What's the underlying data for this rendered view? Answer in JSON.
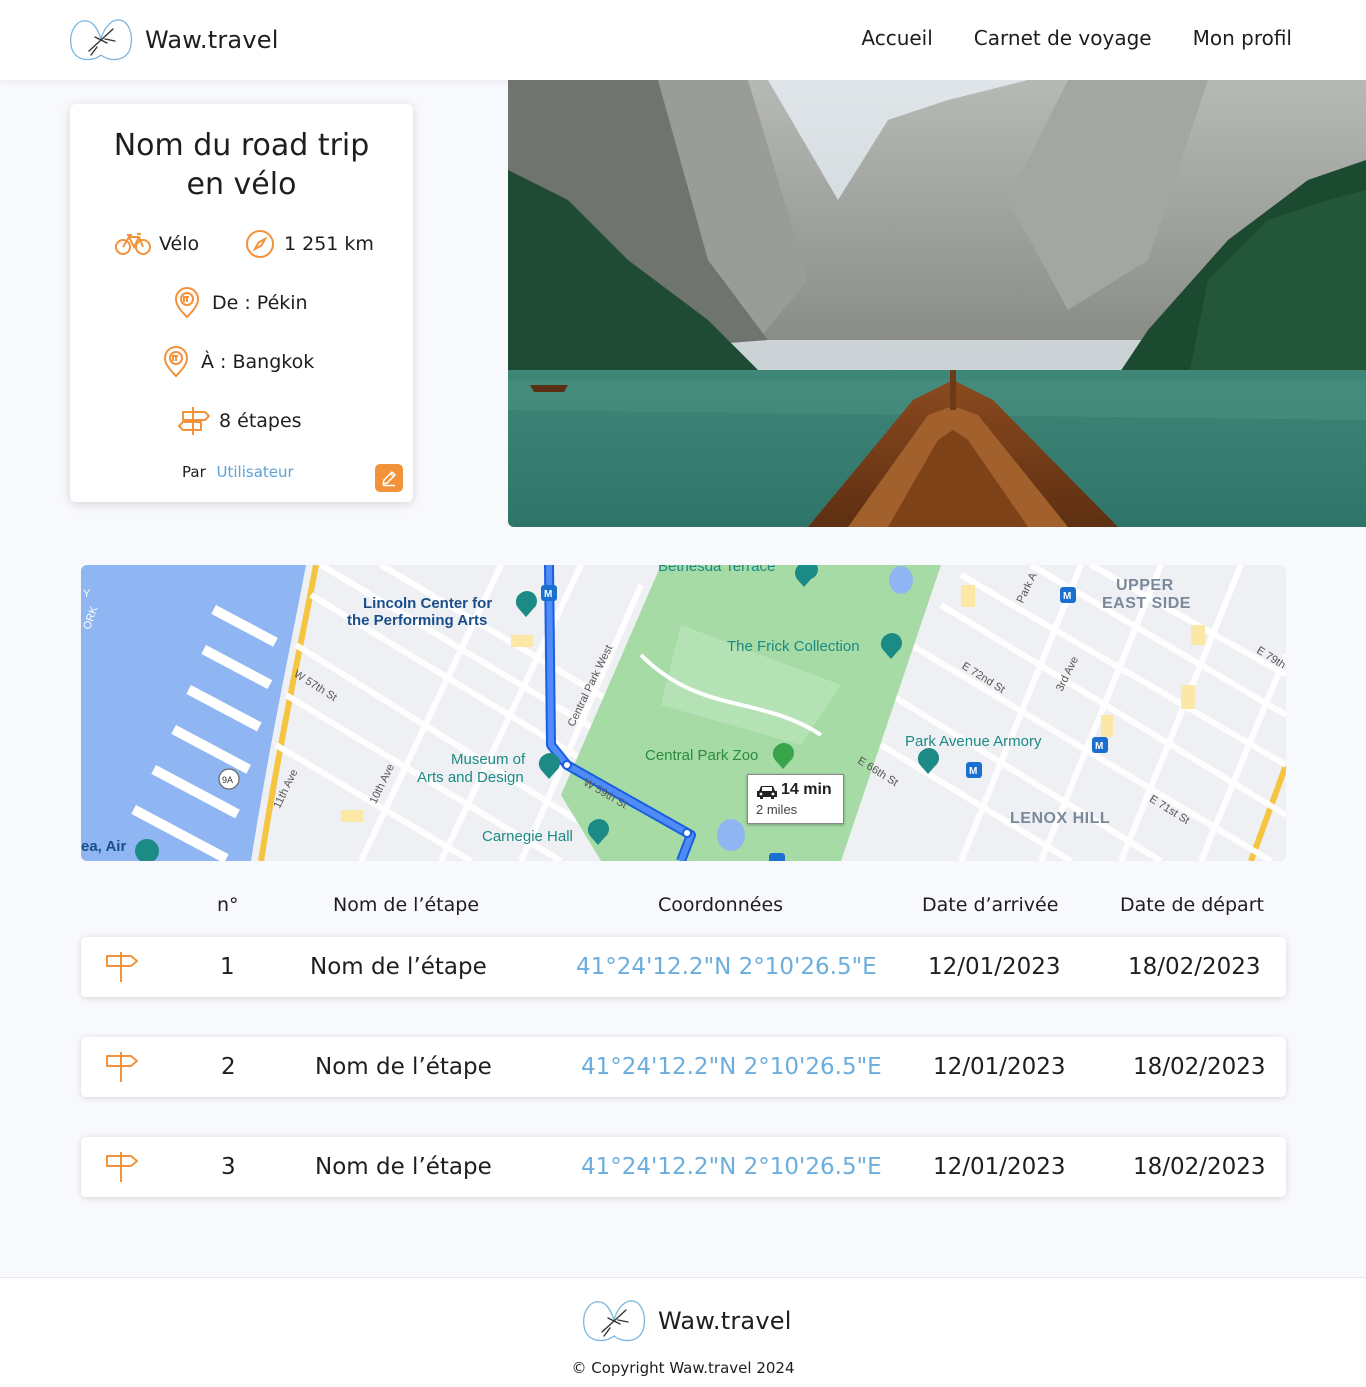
{
  "brand": {
    "name": "Waw.travel"
  },
  "nav": {
    "items": [
      "Accueil",
      "Carnet de voyage",
      "Mon profil"
    ]
  },
  "trip": {
    "title": "Nom du road trip en vélo",
    "mode": "Vélo",
    "distance": "1 251 km",
    "from": "De : Pékin",
    "to": "À : Bangkok",
    "stages": "8 étapes",
    "by_label": "Par",
    "author": "Utilisateur"
  },
  "map": {
    "labels": {
      "lincoln": "Lincoln Center for",
      "lincoln2": "the Performing Arts",
      "bethesda": "Bethesda Terrace",
      "frick": "The Frick Collection",
      "upper": "UPPER",
      "upper2": "EAST SIDE",
      "museum": "Museum of",
      "museum2": "Arts and Design",
      "zoo": "Central Park Zoo",
      "armory": "Park Avenue Armory",
      "carnegie": "Carnegie Hall",
      "lenox": "LENOX HILL",
      "air": "ea, Air",
      "w57": "W 57th St",
      "w59": "W 59th St",
      "cpw": "Central Park West",
      "e72": "E 72nd St",
      "e66": "E 66th St",
      "e71": "E 71st St",
      "e79": "E 79th",
      "third": "3rd Ave",
      "park": "Park A",
      "tenth": "10th Ave",
      "eleventh": "11th Ave",
      "nineA": "9A",
      "york": "Y",
      "york2": "ORK"
    },
    "route": {
      "time": "14 min",
      "distance": "2 miles"
    }
  },
  "table": {
    "headers": [
      "n°",
      "Nom de l’étape",
      "Coordonnées",
      "Date d’arrivée",
      "Date de départ"
    ],
    "rows": [
      {
        "n": "1",
        "name": "Nom de l’étape",
        "coords": "41°24'12.2\"N 2°10'26.5\"E",
        "arrival": "12/01/2023",
        "departure": "18/02/2023"
      },
      {
        "n": "2",
        "name": "Nom de l’étape",
        "coords": "41°24'12.2\"N 2°10'26.5\"E",
        "arrival": "12/01/2023",
        "departure": "18/02/2023"
      },
      {
        "n": "3",
        "name": "Nom de l’étape",
        "coords": "41°24'12.2\"N 2°10'26.5\"E",
        "arrival": "12/01/2023",
        "departure": "18/02/2023"
      }
    ]
  },
  "footer": {
    "copyright": "© Copyright Waw.travel 2024"
  },
  "colors": {
    "accent": "#f2923a",
    "link": "#5aa3d8",
    "coords": "#6baede",
    "background": "#f8f9fd"
  },
  "icons": [
    "bike-icon",
    "compass-icon",
    "location-pin-icon",
    "signpost-icon",
    "pencil-icon",
    "car-icon",
    "museum-pin-icon",
    "metro-icon"
  ]
}
